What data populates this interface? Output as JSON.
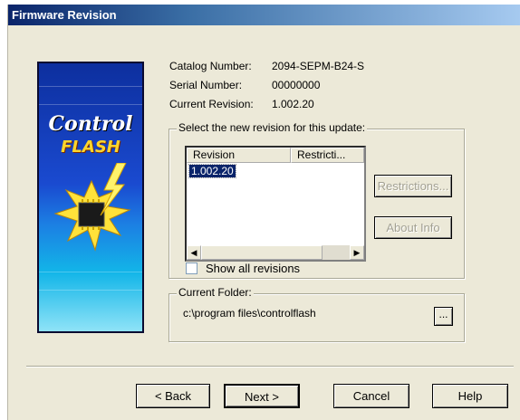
{
  "window": {
    "title": "Firmware Revision"
  },
  "logo": {
    "line1": "Control",
    "line2": "FLASH"
  },
  "info": {
    "catalog_label": "Catalog Number:",
    "catalog_value": "2094-SEPM-B24-S",
    "serial_label": "Serial Number:",
    "serial_value": "00000000",
    "revision_label": "Current Revision:",
    "revision_value": "1.002.20"
  },
  "revision_group": {
    "legend": "Select the new revision for this update:",
    "columns": [
      "Revision",
      "Restricti..."
    ],
    "items": [
      "1.002.20"
    ],
    "show_all_label": "Show all revisions",
    "restrictions_button": "Restrictions...",
    "about_button": "About Info"
  },
  "folder_group": {
    "legend": "Current Folder:",
    "path": "c:\\program files\\controlflash",
    "browse_button": "..."
  },
  "footer": {
    "back": "< Back",
    "next": "Next >",
    "cancel": "Cancel",
    "help": "Help"
  }
}
